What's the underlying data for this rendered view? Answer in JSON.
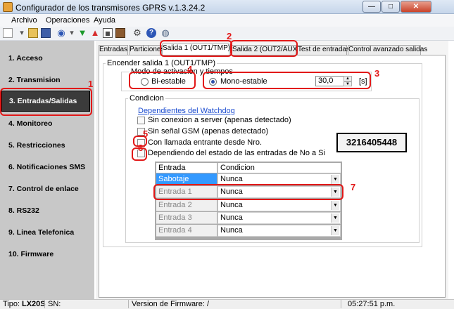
{
  "window": {
    "title": "Configurador de los transmisores GPRS v.1.3.24.2",
    "min": "—",
    "max": "□",
    "close": "✕"
  },
  "menu": [
    "Archivo",
    "Operaciones",
    "Ayuda"
  ],
  "toolbar_icons": [
    "new-icon",
    "open-icon",
    "save-icon",
    "connect-icon",
    "download-icon",
    "upload-icon",
    "calendar-icon",
    "book-icon",
    "settings-icon",
    "help-icon",
    "globe-icon"
  ],
  "sidebar": {
    "items": [
      {
        "label": "1. Acceso"
      },
      {
        "label": "2. Transmision"
      },
      {
        "label": "3. Entradas/Salidas"
      },
      {
        "label": "4. Monitoreo"
      },
      {
        "label": "5. Restricciones"
      },
      {
        "label": "6. Notificaciones SMS"
      },
      {
        "label": "7. Control de enlace"
      },
      {
        "label": "8. RS232"
      },
      {
        "label": "9. Linea Telefonica"
      },
      {
        "label": "10. Firmware"
      }
    ],
    "active": 2
  },
  "tabs": [
    {
      "label": "Entradas"
    },
    {
      "label": "Particiones"
    },
    {
      "label": "Salida 1 (OUT1/TMP)"
    },
    {
      "label": "Salida 2 (OUT2/AUX)"
    },
    {
      "label": "Test de entradas"
    },
    {
      "label": "Control avanzado salidas"
    }
  ],
  "panel": {
    "outer_group": "Encender salida 1 (OUT1/TMP)",
    "mode_group": "Modo de activacion y tiempos",
    "bistable": "Bi-estable",
    "monostable": "Mono-estable",
    "time_value": "30,0",
    "time_unit": "[s]",
    "cond_group": "Condicion",
    "watchdog_link": "Dependientes del Watchdog",
    "cb_server": "Sin conexion a server (apenas detectado)",
    "cb_gsm": "Sin señal GSM (apenas detectado)",
    "cb_call": "Con llamada entrante desde Nro.",
    "cb_inputs": "Dependiendo del estado de las entradas de No a Si",
    "phone": "3216405448"
  },
  "grid": {
    "headers": [
      "Entrada",
      "Condicion"
    ],
    "rows": [
      {
        "entrada": "Sabotaje",
        "condicion": "Nunca"
      },
      {
        "entrada": "Entrada 1",
        "condicion": "Nunca"
      },
      {
        "entrada": "Entrada 2",
        "condicion": "Nunca"
      },
      {
        "entrada": "Entrada 3",
        "condicion": "Nunca"
      },
      {
        "entrada": "Entrada 4",
        "condicion": "Nunca"
      }
    ]
  },
  "annotations": [
    "1",
    "2",
    "3",
    "4",
    "5",
    "6",
    "7"
  ],
  "status": {
    "tipo_label": "Tipo:",
    "tipo": "LX20S",
    "sn": "SN:",
    "firmware": "Version de Firmware: /",
    "time": "05:27:51 p.m."
  },
  "colors": {
    "accent": "#3399ff",
    "annotation": "#e21818",
    "active_item": "#3b3b3b"
  }
}
